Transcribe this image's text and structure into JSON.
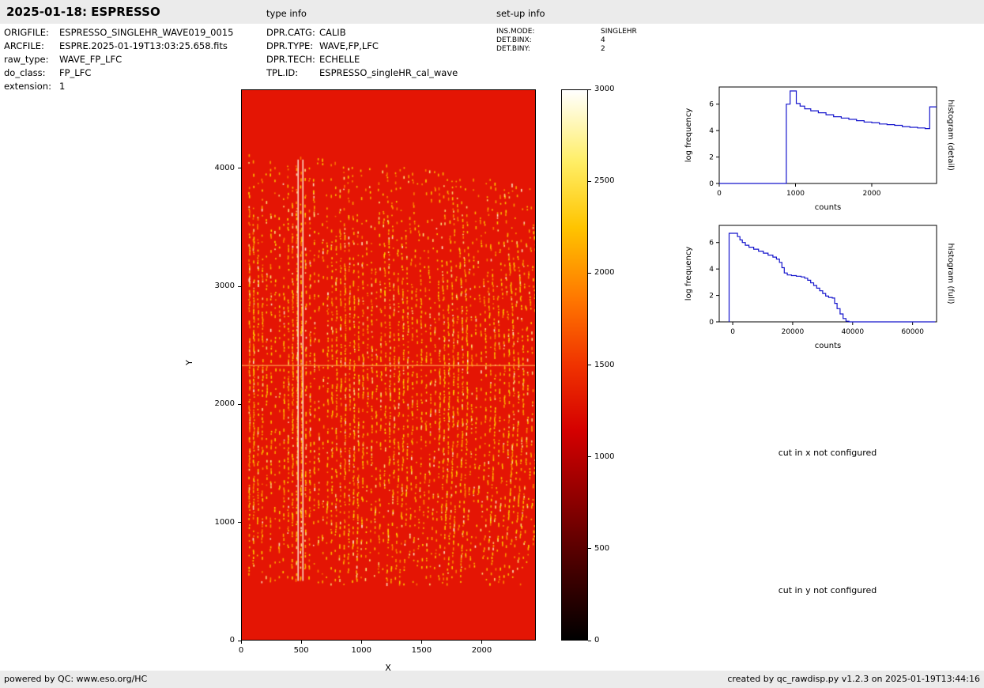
{
  "header": {
    "title": "2025-01-18: ESPRESSO",
    "type_info_label": "type info",
    "setup_info_label": "set-up info"
  },
  "metadata": {
    "left": [
      {
        "label": "ORIGFILE:",
        "value": "ESPRESSO_SINGLEHR_WAVE019_0015"
      },
      {
        "label": "ARCFILE:",
        "value": "ESPRE.2025-01-19T13:03:25.658.fits"
      },
      {
        "label": "raw_type:",
        "value": "WAVE_FP_LFC"
      },
      {
        "label": "do_class:",
        "value": "FP_LFC"
      },
      {
        "label": "extension:",
        "value": "1"
      }
    ],
    "type_info": [
      {
        "label": "DPR.CATG:",
        "value": "CALIB"
      },
      {
        "label": "DPR.TYPE:",
        "value": "WAVE,FP,LFC"
      },
      {
        "label": "DPR.TECH:",
        "value": "ECHELLE"
      },
      {
        "label": "TPL.ID:",
        "value": "ESPRESSO_singleHR_cal_wave"
      }
    ],
    "setup_info": [
      {
        "label": "INS.MODE:",
        "value": "SINGLEHR"
      },
      {
        "label": "DET.BINX:",
        "value": "4"
      },
      {
        "label": "DET.BINY:",
        "value": "2"
      }
    ]
  },
  "messages": {
    "cut_x": "cut in x not configured",
    "cut_y": "cut in y not configured"
  },
  "footer": {
    "left": "powered by QC: www.eso.org/HC",
    "right": "created by qc_rawdisp.py v1.2.3 on 2025-01-19T13:44:16"
  },
  "chart_data": [
    {
      "id": "raw_frame_image",
      "type": "heatmap",
      "xlabel": "X",
      "ylabel": "Y",
      "xlim": [
        0,
        2450
      ],
      "ylim": [
        0,
        4670
      ],
      "xticks": [
        0,
        500,
        1000,
        1500,
        2000
      ],
      "yticks": [
        0,
        1000,
        2000,
        3000,
        4000
      ],
      "colormap": "hot",
      "value_range": [
        0,
        3000
      ],
      "description": "Raw ESPRESSO echelle calibration frame: uniform red background near 1000 counts with ~66 curved, nearly vertical echelle orders of bright yellow/orange LFC-FP emission speckles spanning y=500 to y=4100, curvature increasing toward the right edge, two saturated whitish columns near x=470-510 and a bright horizontal detector seam at y=2330.",
      "pattern": {
        "background_color": "#e41504",
        "columns": 66,
        "x_start": 60,
        "x_end": 2400,
        "y_bottom": 470,
        "y_top": 4120,
        "top_droop": 260,
        "bend_min": 5,
        "bend_max": 110,
        "seam_y": 2330,
        "seam_color": "rgba(255,150,70,0.9)",
        "bright_columns_x": [
          470,
          510
        ],
        "bright_column_color": "#fffbe8",
        "dash_colors": [
          "#ffd400",
          "#ffb300",
          "#ff8800",
          "#ffef80",
          "#fff6d0"
        ]
      }
    },
    {
      "id": "colorbar",
      "type": "colorbar",
      "vmin": 0,
      "vmax": 3000,
      "ticks": [
        0,
        500,
        1000,
        1500,
        2000,
        2500,
        3000
      ],
      "colormap": "hot",
      "gradient_stops": [
        [
          0,
          "#000000"
        ],
        [
          0.12,
          "#400000"
        ],
        [
          0.25,
          "#8b0000"
        ],
        [
          0.38,
          "#d40000"
        ],
        [
          0.5,
          "#f03300"
        ],
        [
          0.62,
          "#ff7700"
        ],
        [
          0.75,
          "#ffc400"
        ],
        [
          0.87,
          "#ffee66"
        ],
        [
          1,
          "#ffffff"
        ]
      ]
    },
    {
      "id": "histogram_detail",
      "type": "line",
      "style": "step",
      "side_label": "histogram (detail)",
      "xlabel": "counts",
      "ylabel": "log frequency",
      "xlim": [
        0,
        2850
      ],
      "ylim": [
        0,
        7.3
      ],
      "xticks": [
        0,
        1000,
        2000
      ],
      "yticks": [
        0,
        2,
        4,
        6
      ],
      "line_color": "#1414cc",
      "points": [
        [
          0,
          0
        ],
        [
          880,
          0
        ],
        [
          880,
          6.0
        ],
        [
          930,
          6.0
        ],
        [
          930,
          7.0
        ],
        [
          1010,
          7.0
        ],
        [
          1010,
          6.05
        ],
        [
          1060,
          5.85
        ],
        [
          1120,
          5.65
        ],
        [
          1200,
          5.5
        ],
        [
          1300,
          5.35
        ],
        [
          1400,
          5.2
        ],
        [
          1500,
          5.05
        ],
        [
          1600,
          4.95
        ],
        [
          1700,
          4.85
        ],
        [
          1800,
          4.75
        ],
        [
          1900,
          4.65
        ],
        [
          2000,
          4.6
        ],
        [
          2100,
          4.5
        ],
        [
          2200,
          4.45
        ],
        [
          2300,
          4.4
        ],
        [
          2400,
          4.3
        ],
        [
          2500,
          4.25
        ],
        [
          2600,
          4.2
        ],
        [
          2700,
          4.15
        ],
        [
          2760,
          4.15
        ],
        [
          2760,
          5.8
        ],
        [
          2850,
          5.8
        ]
      ]
    },
    {
      "id": "histogram_full",
      "type": "line",
      "style": "step",
      "side_label": "histogram (full)",
      "xlabel": "counts",
      "ylabel": "log frequency",
      "xlim": [
        -4500,
        68000
      ],
      "ylim": [
        0,
        7.3
      ],
      "xticks": [
        0,
        20000,
        40000,
        60000
      ],
      "yticks": [
        0,
        2,
        4,
        6
      ],
      "line_color": "#1414cc",
      "points": [
        [
          -1200,
          0
        ],
        [
          -1200,
          6.7
        ],
        [
          800,
          6.7
        ],
        [
          1600,
          6.45
        ],
        [
          2400,
          6.2
        ],
        [
          3200,
          6.0
        ],
        [
          4200,
          5.8
        ],
        [
          5400,
          5.65
        ],
        [
          7000,
          5.5
        ],
        [
          8600,
          5.35
        ],
        [
          10200,
          5.2
        ],
        [
          11800,
          5.05
        ],
        [
          13400,
          4.9
        ],
        [
          14600,
          4.75
        ],
        [
          15600,
          4.5
        ],
        [
          16400,
          4.1
        ],
        [
          17200,
          3.7
        ],
        [
          18200,
          3.55
        ],
        [
          19600,
          3.5
        ],
        [
          21200,
          3.45
        ],
        [
          22800,
          3.4
        ],
        [
          24000,
          3.3
        ],
        [
          25000,
          3.15
        ],
        [
          26000,
          2.95
        ],
        [
          27000,
          2.75
        ],
        [
          28000,
          2.55
        ],
        [
          29000,
          2.35
        ],
        [
          30000,
          2.15
        ],
        [
          31000,
          1.95
        ],
        [
          32000,
          1.85
        ],
        [
          33200,
          1.8
        ],
        [
          34000,
          1.4
        ],
        [
          34800,
          1.0
        ],
        [
          35800,
          0.6
        ],
        [
          36800,
          0.25
        ],
        [
          37800,
          0.05
        ],
        [
          38800,
          0
        ],
        [
          67500,
          0
        ]
      ]
    }
  ]
}
